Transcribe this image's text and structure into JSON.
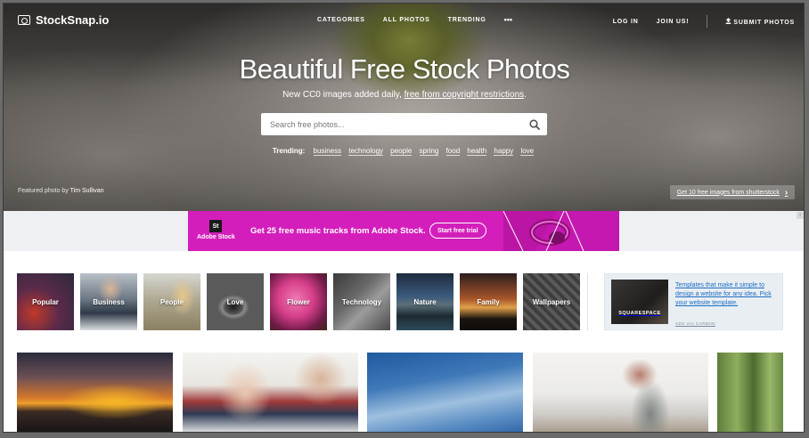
{
  "header": {
    "logo_text": "StockSnap.io",
    "nav_main": [
      "CATEGORIES",
      "ALL PHOTOS",
      "TRENDING"
    ],
    "more_label": "•••",
    "nav_right": {
      "login": "LOG IN",
      "join": "JOIN US!",
      "submit": "SUBMIT PHOTOS"
    }
  },
  "hero": {
    "title": "Beautiful Free Stock Photos",
    "subtitle_prefix": "New CC0 images added daily, ",
    "subtitle_link": "free from copyright restrictions",
    "subtitle_suffix": ".",
    "search_placeholder": "Search free photos...",
    "trending_label": "Trending:",
    "trending_tags": [
      "business",
      "technology",
      "people",
      "spring",
      "food",
      "health",
      "happy",
      "love"
    ],
    "featured_prefix": "Featured photo by ",
    "featured_author": "Tim Sullivan",
    "shutterstock_cta": "Get 10 free images from shutterstock",
    "shutterstock_arrow": "›"
  },
  "adobe_ad": {
    "logo_mark": "St",
    "logo_name": "Adobe Stock",
    "headline": "Get 25 free music tracks from Adobe Stock.",
    "cta": "Start free trial",
    "corner_mark": "i",
    "colors": {
      "background": "#d41ebb"
    }
  },
  "categories": [
    {
      "label": "Popular"
    },
    {
      "label": "Business"
    },
    {
      "label": "People"
    },
    {
      "label": "Love"
    },
    {
      "label": "Flower"
    },
    {
      "label": "Technology"
    },
    {
      "label": "Nature"
    },
    {
      "label": "Family"
    },
    {
      "label": "Wallpapers"
    }
  ],
  "carbon_ad": {
    "brand": "SQUARESPACE",
    "text": "Templates that make it simple to design a website for any idea. Pick your website template.",
    "via": "ADS VIA CARBON",
    "colors": {
      "link": "#1b6ec2"
    }
  },
  "photos": [
    {
      "name": "sunset-city-photo"
    },
    {
      "name": "business-meeting-photo"
    },
    {
      "name": "blue-sky-photo"
    },
    {
      "name": "interior-vase-photo"
    },
    {
      "name": "forest-photo"
    }
  ]
}
